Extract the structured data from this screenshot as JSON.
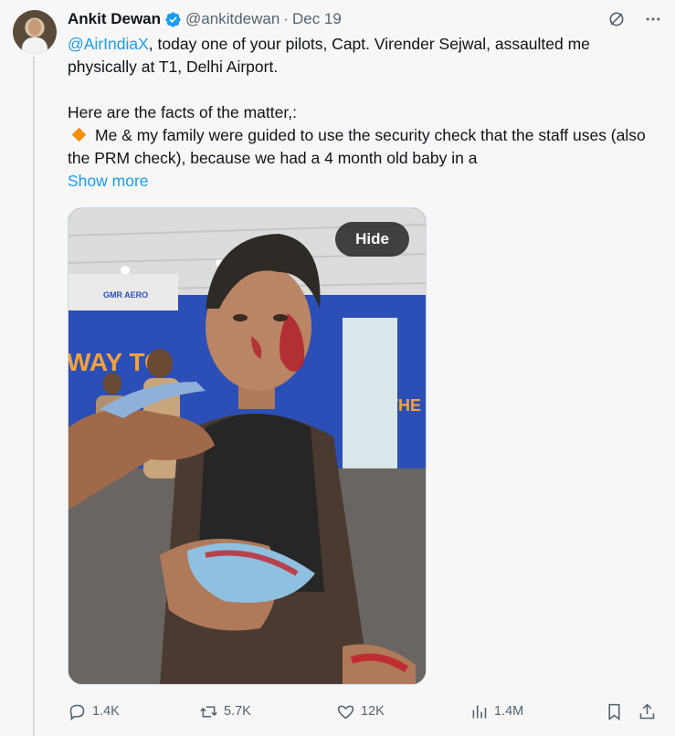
{
  "author": {
    "name": "Ankit Dewan",
    "handle": "@ankitdewan",
    "separator": "·",
    "date": "Dec 19",
    "verified": true
  },
  "tweet": {
    "mention": "@AirIndiaX",
    "line1_rest": ", today one of your pilots, Capt. Virender Sejwal, assaulted me physically at T1, Delhi Airport.",
    "line2": "Here are the facts of the matter,:",
    "bullet_text": "Me & my family were guided to use the security check that the staff uses (also the PRM check), because we had a 4 month old baby in a",
    "show_more": "Show more"
  },
  "media": {
    "hide_label": "Hide",
    "sign_text_left": "WAY TO",
    "sign_text_right": "THE GA",
    "airport_logo_text": "GMR AERO"
  },
  "actions": {
    "replies": "1.4K",
    "reposts": "5.7K",
    "likes": "12K",
    "views": "1.4M"
  },
  "colors": {
    "accent": "#1d9bf0",
    "secondary_text": "#536471",
    "bullet": "#f4900c"
  },
  "icons": [
    "verified-badge-icon",
    "grok-icon",
    "more-icon",
    "reply-icon",
    "repost-icon",
    "like-icon",
    "views-icon",
    "bookmark-icon",
    "share-icon"
  ]
}
